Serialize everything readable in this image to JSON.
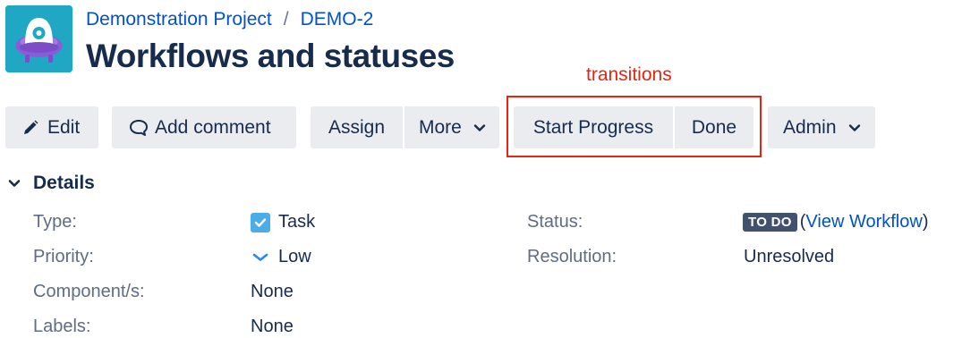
{
  "breadcrumb": {
    "project": "Demonstration Project",
    "separator": "/",
    "issue_key": "DEMO-2"
  },
  "page": {
    "title": "Workflows and statuses"
  },
  "annotation": {
    "label": "transitions",
    "color": "#e8230e"
  },
  "toolbar": {
    "edit": "Edit",
    "add_comment": "Add comment",
    "assign": "Assign",
    "more": "More",
    "start_progress": "Start Progress",
    "done": "Done",
    "admin": "Admin"
  },
  "details": {
    "heading": "Details",
    "type": {
      "label": "Type:",
      "value": "Task",
      "icon": "task-checkbox-icon"
    },
    "priority": {
      "label": "Priority:",
      "value": "Low",
      "icon": "priority-low-icon"
    },
    "components": {
      "label": "Component/s:",
      "value": "None"
    },
    "labels": {
      "label": "Labels:",
      "value": "None"
    },
    "status": {
      "label": "Status:",
      "value": "TO DO",
      "open_paren": "(",
      "workflow_link": "View Workflow",
      "close_paren": ")"
    },
    "resolution": {
      "label": "Resolution:",
      "value": "Unresolved"
    }
  },
  "colors": {
    "link": "#0052cc",
    "button_bg": "#ebecf0",
    "text": "#172b4d",
    "label": "#5e6c84",
    "status_lozenge": "#42526e",
    "task_icon": "#4bade8",
    "avatar_bg": "#1fa7c4"
  }
}
